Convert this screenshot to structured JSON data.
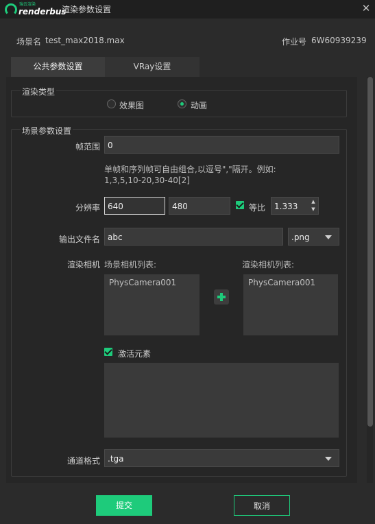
{
  "window": {
    "brand_small": "瑞云渲染",
    "brand": "renderbus",
    "title": "渲染参数设置",
    "close_glyph": "✕"
  },
  "info": {
    "scene_label": "场景名",
    "scene_value": "test_max2018.max",
    "job_label": "作业号",
    "job_value": "6W60939239"
  },
  "tabs": [
    {
      "label": "公共参数设置",
      "active": true
    },
    {
      "label": "VRay设置",
      "active": false
    }
  ],
  "render_type": {
    "legend": "渲染类型",
    "options": [
      {
        "label": "效果图",
        "selected": false
      },
      {
        "label": "动画",
        "selected": true
      }
    ]
  },
  "scene_params": {
    "legend": "场景参数设置",
    "frame_range_label": "帧范围",
    "frame_range_value": "0",
    "hint_line1": "单帧和序列帧可自由组合,以逗号\",\"隔开。例如:",
    "hint_line2": "1,3,5,10-20,30-40[2]",
    "resolution_label": "分辨率",
    "width": "640",
    "height": "480",
    "ratio_checked": true,
    "ratio_label": "等比",
    "ratio_value": "1.333",
    "output_label": "输出文件名",
    "output_value": "abc",
    "output_ext": ".png",
    "camera_label": "渲染相机",
    "scene_cameras_label": "场景相机列表:",
    "scene_cameras": [
      "PhysCamera001"
    ],
    "render_cameras_label": "渲染相机列表:",
    "render_cameras": [
      "PhysCamera001"
    ],
    "activate_checked": true,
    "activate_label": "激活元素",
    "channel_label": "通道格式",
    "channel_value": ".tga"
  },
  "buttons": {
    "submit": "提交",
    "cancel": "取消"
  },
  "colors": {
    "accent": "#1ecb7b",
    "background": "#2b2b2b",
    "panel": "#262626",
    "input": "#3a3a3a"
  }
}
